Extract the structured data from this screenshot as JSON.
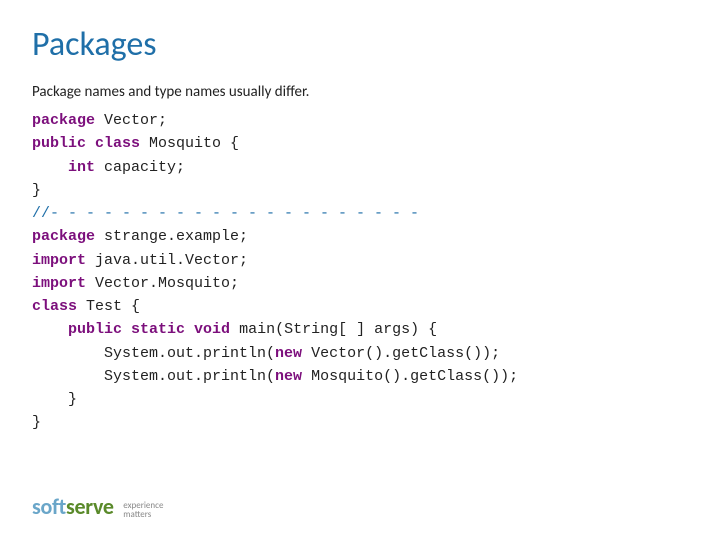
{
  "title": "Packages",
  "intro": "Package names and type names usually differ.",
  "code": {
    "l1_kw": "package",
    "l1_t": " Vector;",
    "l2_kw1": "public",
    "l2_kw2": " class",
    "l2_t": " Mosquito {",
    "l3_kw": "int",
    "l3_t": " capacity;",
    "l4": "}",
    "l5": "//- - - - - - - - - - - - - - - - - - - - -",
    "l6_kw": "package",
    "l6_t": " strange.example;",
    "l7_kw": "import",
    "l7_t": " java.util.Vector;",
    "l8_kw": "import",
    "l8_t": " Vector.Mosquito;",
    "l9_kw": "class",
    "l9_t": " Test {",
    "l10_kw1": "public",
    "l10_kw2": " static",
    "l10_kw3": " void",
    "l10_t": " main(String[ ] args) {",
    "l11_a": "        System.out.println(",
    "l11_kw": "new",
    "l11_b": " Vector().getClass());",
    "l12_a": "        System.out.println(",
    "l12_kw": "new",
    "l12_b": " Mosquito().getClass());",
    "l13": "    }",
    "l14": "}"
  },
  "logo": {
    "part1": "soft",
    "part2": "serve",
    "tagline1": "experience",
    "tagline2": "matters"
  }
}
